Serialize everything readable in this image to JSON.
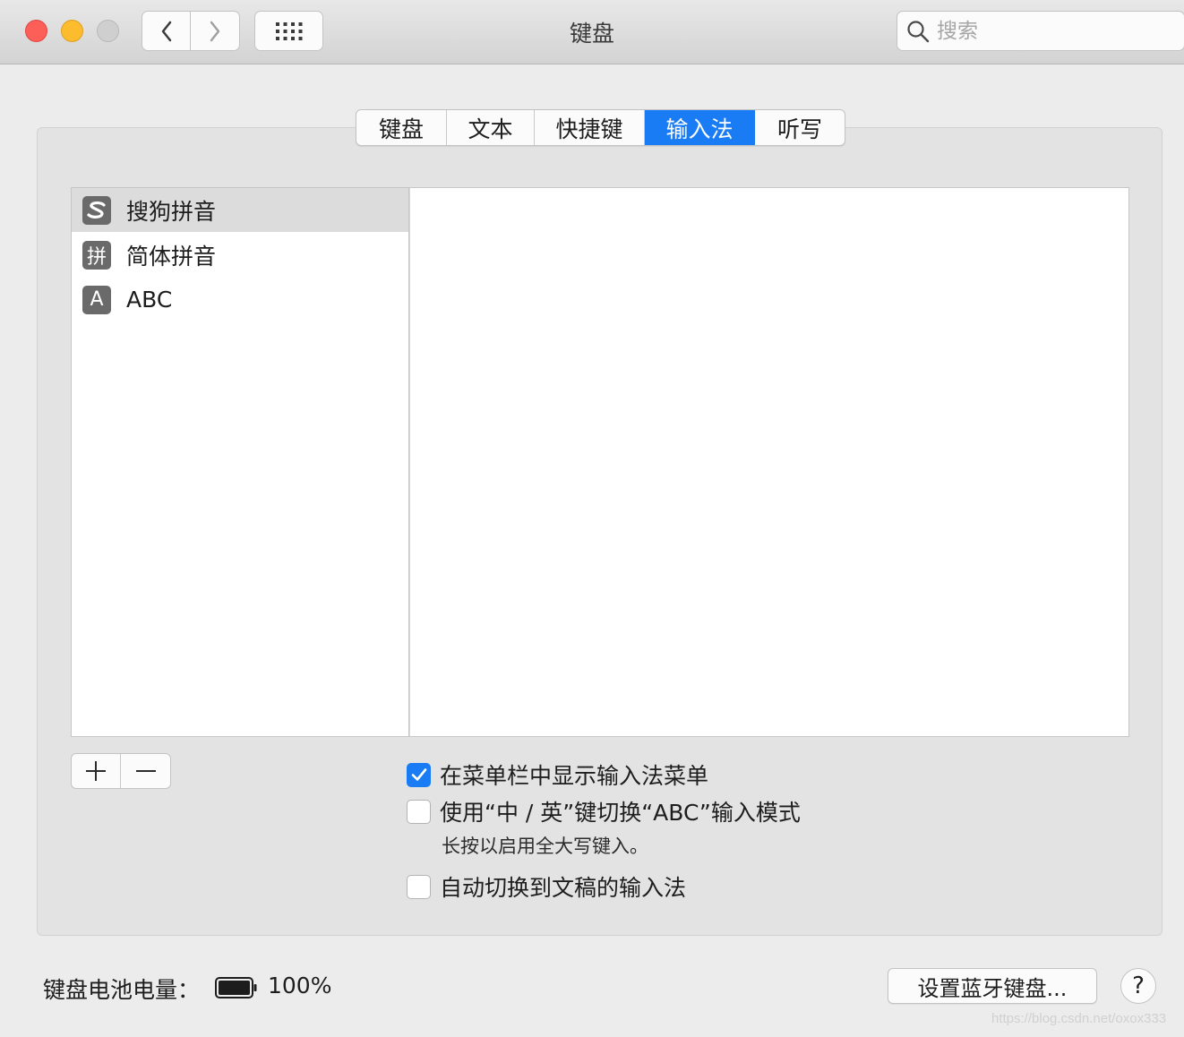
{
  "window": {
    "title": "键盘",
    "traffic_lights": {
      "close_color": "#fc5f57",
      "minimize_color": "#fdbc2e",
      "zoom_color": "#cfcfcf"
    }
  },
  "toolbar": {
    "back_icon": "chevron-left-icon",
    "forward_icon": "chevron-right-icon",
    "grid_icon": "grid-icon",
    "search": {
      "placeholder": "搜索",
      "value": ""
    }
  },
  "tabs": [
    {
      "label": "键盘",
      "active": false
    },
    {
      "label": "文本",
      "active": false
    },
    {
      "label": "快捷键",
      "active": false
    },
    {
      "label": "输入法",
      "active": true
    },
    {
      "label": "听写",
      "active": false
    }
  ],
  "input_sources": [
    {
      "label": "搜狗拼音",
      "icon": "sogou-s-icon",
      "icon_text": "S",
      "selected": true
    },
    {
      "label": "简体拼音",
      "icon": "pinyin-icon",
      "icon_text": "拼",
      "selected": false
    },
    {
      "label": "ABC",
      "icon": "abc-icon",
      "icon_text": "A",
      "selected": false
    }
  ],
  "list_controls": {
    "add_icon": "plus-icon",
    "remove_icon": "minus-icon"
  },
  "options": [
    {
      "label": "在菜单栏中显示输入法菜单",
      "checked": true
    },
    {
      "label": "使用“中 / 英”键切换“ABC”输入模式",
      "checked": false,
      "hint": "长按以启用全大写键入。"
    },
    {
      "label": "自动切换到文稿的输入法",
      "checked": false
    }
  ],
  "footer": {
    "battery_label": "键盘电池电量：",
    "battery_value": "100%",
    "battery_icon": "battery-icon",
    "bluetooth_button": "设置蓝牙键盘...",
    "help_button": "?",
    "watermark": "https://blog.csdn.net/oxox333"
  },
  "colors": {
    "accent": "#1a7cf5",
    "selected_row": "#dcdcdc"
  }
}
